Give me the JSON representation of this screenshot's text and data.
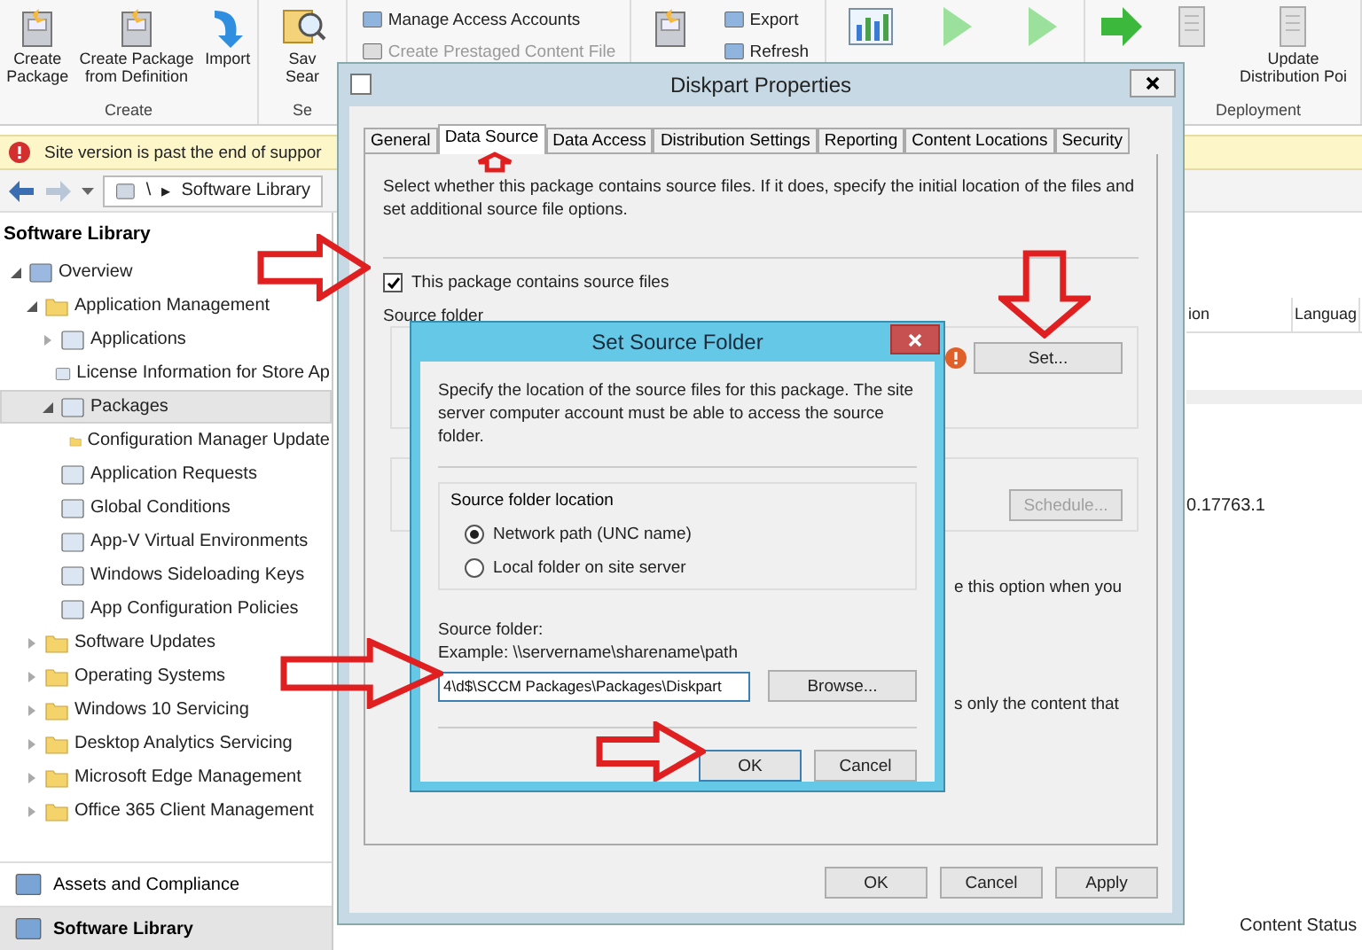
{
  "ribbon": {
    "groups": [
      {
        "label": "Create",
        "buttons": [
          {
            "kind": "big",
            "lines": [
              "Create",
              "Package"
            ]
          },
          {
            "kind": "big",
            "lines": [
              "Create Package",
              "from Definition"
            ]
          },
          {
            "kind": "big",
            "lines": [
              "Import"
            ]
          }
        ]
      },
      {
        "label": "Se",
        "buttons": [
          {
            "kind": "big",
            "lines": [
              "Sav",
              "Sear"
            ]
          }
        ]
      },
      {
        "buttons": [
          {
            "kind": "small",
            "label": "Manage Access Accounts",
            "disabled": false
          },
          {
            "kind": "small",
            "label": "Create Prestaged Content File",
            "disabled": true
          }
        ]
      },
      {
        "buttons": [
          {
            "kind": "big"
          },
          {
            "kind": "small",
            "label": "Export",
            "disabled": false
          },
          {
            "kind": "small",
            "label": "Refresh",
            "disabled": false
          }
        ]
      },
      {
        "buttons": [
          {
            "kind": "big"
          },
          {
            "kind": "big"
          },
          {
            "kind": "big"
          }
        ]
      },
      {
        "label": "Deployment",
        "buttons": [
          {
            "kind": "big"
          },
          {
            "kind": "big"
          },
          {
            "kind": "big",
            "lines": [
              "Update",
              "Distribution Poi"
            ]
          }
        ]
      }
    ]
  },
  "warning": "Site version is past the end of suppor",
  "address_bar": {
    "separator": "\\",
    "chevron": "▸",
    "location": "Software Library"
  },
  "navigation": {
    "heading": "Software Library",
    "tree": [
      {
        "label": "Overview",
        "kind": "overview",
        "expanded": true,
        "selected": false,
        "children": [
          {
            "label": "Application Management",
            "kind": "folder",
            "expanded": true,
            "selected": false,
            "children": [
              {
                "label": "Applications",
                "kind": "node",
                "expanded": false,
                "selected": false
              },
              {
                "label": "License Information for Store Ap",
                "kind": "node",
                "selected": false
              },
              {
                "label": "Packages",
                "kind": "node",
                "expanded": true,
                "selected": true,
                "children": [
                  {
                    "label": "Configuration Manager Update",
                    "kind": "folder",
                    "selected": false
                  }
                ]
              },
              {
                "label": "Application Requests",
                "kind": "node",
                "selected": false
              },
              {
                "label": "Global Conditions",
                "kind": "node",
                "selected": false
              },
              {
                "label": "App-V Virtual Environments",
                "kind": "node",
                "selected": false
              },
              {
                "label": "Windows Sideloading Keys",
                "kind": "node",
                "selected": false
              },
              {
                "label": "App Configuration Policies",
                "kind": "node",
                "selected": false
              }
            ]
          },
          {
            "label": "Software Updates",
            "kind": "folder",
            "expanded": false,
            "selected": false
          },
          {
            "label": "Operating Systems",
            "kind": "folder",
            "expanded": false,
            "selected": false
          },
          {
            "label": "Windows 10 Servicing",
            "kind": "folder",
            "expanded": false,
            "selected": false
          },
          {
            "label": "Desktop Analytics Servicing",
            "kind": "folder",
            "expanded": false,
            "selected": false
          },
          {
            "label": "Microsoft Edge Management",
            "kind": "folder",
            "expanded": false,
            "selected": false
          },
          {
            "label": "Office 365 Client Management",
            "kind": "folder",
            "expanded": false,
            "selected": false
          }
        ]
      }
    ],
    "workspaces": [
      {
        "label": "Assets and Compliance",
        "selected": false
      },
      {
        "label": "Software Library",
        "selected": true
      }
    ]
  },
  "content": {
    "columns": [
      "ion",
      "Languag"
    ],
    "cell": "0.17763.1",
    "details_tab": "Content Status"
  },
  "properties_dialog": {
    "title": "Diskpart Properties",
    "tabs": [
      {
        "label": "General",
        "selected": false
      },
      {
        "label": "Data Source",
        "selected": true
      },
      {
        "label": "Data Access",
        "selected": false
      },
      {
        "label": "Distribution Settings",
        "selected": false
      },
      {
        "label": "Reporting",
        "selected": false
      },
      {
        "label": "Content Locations",
        "selected": false
      },
      {
        "label": "Security",
        "selected": false
      }
    ],
    "description": "Select whether this package contains source files. If it does, specify the initial location of the files and set additional source file options.",
    "contains_source": {
      "label": "This package contains source files",
      "checked": true
    },
    "source_folder_label": "Source folder",
    "set_button": "Set...",
    "schedule_button": {
      "label": "Schedule...",
      "disabled": true
    },
    "option_texts": [
      "e this option when you",
      "s only the content that"
    ],
    "buttons": [
      "OK",
      "Cancel",
      "Apply"
    ]
  },
  "source_dialog": {
    "title": "Set Source Folder",
    "description": "Specify the location of the source files for this package. The site server computer account must be able to access the source folder.",
    "location_group": "Source folder location",
    "options": [
      {
        "label": "Network path (UNC name)",
        "selected": true
      },
      {
        "label": "Local folder on site server",
        "selected": false
      }
    ],
    "folder_label": "Source folder:",
    "example": "Example: \\\\servername\\sharename\\path",
    "folder_value": "4\\d$\\SCCM Packages\\Packages\\Diskpart",
    "browse_button": "Browse...",
    "buttons": [
      {
        "label": "OK",
        "default": true
      },
      {
        "label": "Cancel",
        "default": false
      }
    ]
  }
}
